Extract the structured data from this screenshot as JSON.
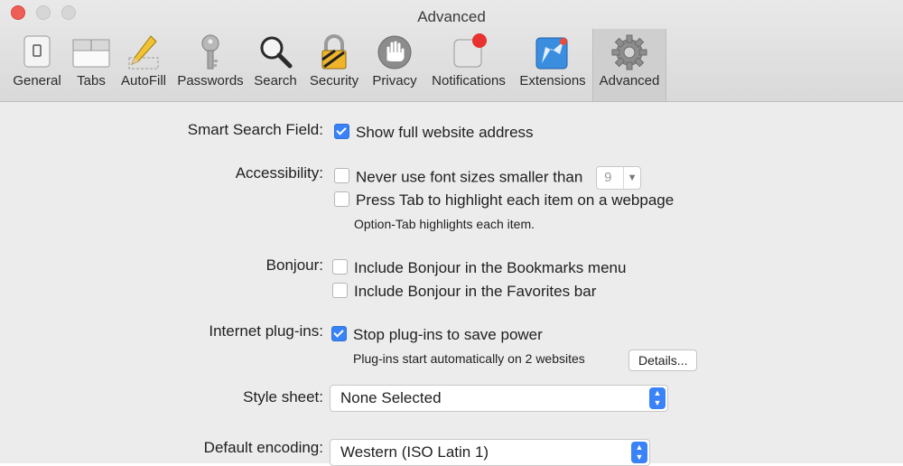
{
  "window": {
    "title": "Advanced"
  },
  "toolbar": {
    "tabs": [
      {
        "label": "General",
        "icon": "general-icon"
      },
      {
        "label": "Tabs",
        "icon": "tabs-icon"
      },
      {
        "label": "AutoFill",
        "icon": "autofill-pencil-icon"
      },
      {
        "label": "Passwords",
        "icon": "key-icon"
      },
      {
        "label": "Search",
        "icon": "magnifier-icon"
      },
      {
        "label": "Security",
        "icon": "padlock-icon"
      },
      {
        "label": "Privacy",
        "icon": "hand-icon"
      },
      {
        "label": "Notifications",
        "icon": "notification-badge-icon"
      },
      {
        "label": "Extensions",
        "icon": "puzzle-icon"
      },
      {
        "label": "Advanced",
        "icon": "gear-icon"
      }
    ],
    "active_tab": "Advanced"
  },
  "settings": {
    "smart_search": {
      "label": "Smart Search Field:",
      "show_full_address": {
        "label": "Show full website address",
        "checked": true
      }
    },
    "accessibility": {
      "label": "Accessibility:",
      "min_font": {
        "label": "Never use font sizes smaller than",
        "checked": false,
        "value": "9"
      },
      "tab_highlight": {
        "label": "Press Tab to highlight each item on a webpage",
        "checked": false
      },
      "note": "Option-Tab highlights each item."
    },
    "bonjour": {
      "label": "Bonjour:",
      "bookmarks": {
        "label": "Include Bonjour in the Bookmarks menu",
        "checked": false
      },
      "favorites": {
        "label": "Include Bonjour in the Favorites bar",
        "checked": false
      }
    },
    "plugins": {
      "label": "Internet plug-ins:",
      "stop_plugins": {
        "label": "Stop plug-ins to save power",
        "checked": true
      },
      "note": "Plug-ins start automatically on 2 websites",
      "details_button": "Details..."
    },
    "style_sheet": {
      "label": "Style sheet:",
      "value": "None Selected"
    },
    "default_encoding": {
      "label": "Default encoding:",
      "value": "Western (ISO Latin 1)"
    }
  },
  "colors": {
    "accent": "#3a82f7",
    "close_button": "#ee5e57",
    "notification_badge": "#e8322f"
  }
}
